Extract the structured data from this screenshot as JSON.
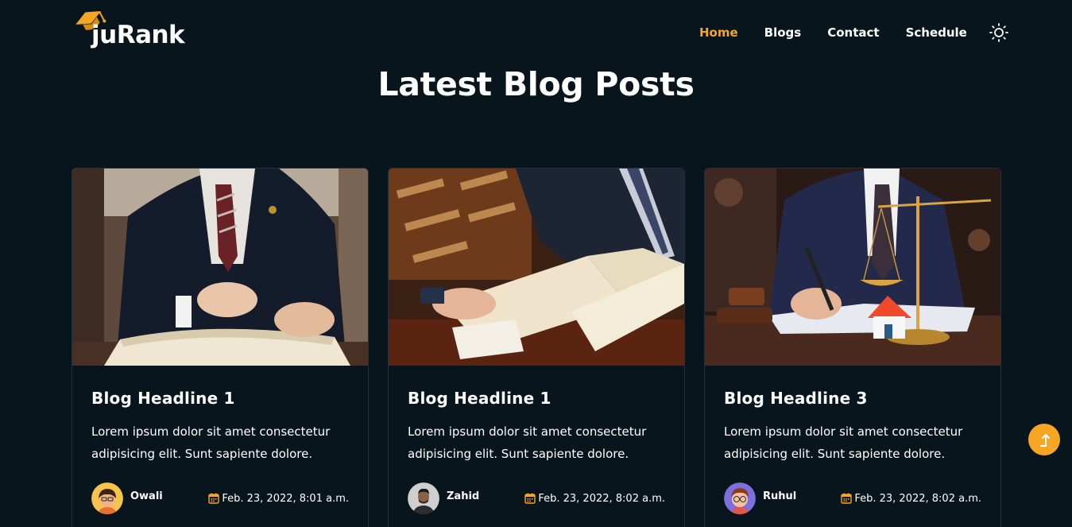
{
  "brand": {
    "name": "juRank",
    "logo_icon": "graduation-cap-icon",
    "accent": "#f6a623"
  },
  "nav": {
    "items": [
      {
        "label": "Home",
        "active": true
      },
      {
        "label": "Blogs",
        "active": false
      },
      {
        "label": "Contact",
        "active": false
      },
      {
        "label": "Schedule",
        "active": false
      }
    ],
    "theme_toggle_icon": "sun-icon"
  },
  "section": {
    "title": "Latest Blog Posts"
  },
  "posts": [
    {
      "title": "Blog Headline 1",
      "excerpt": "Lorem ipsum dolor sit amet consectetur adipisicing elit. Sunt sapiente dolore.",
      "author": "Owali",
      "date": "Feb. 23, 2022, 8:01 a.m."
    },
    {
      "title": "Blog Headline 1",
      "excerpt": "Lorem ipsum dolor sit amet consectetur adipisicing elit. Sunt sapiente dolore.",
      "author": "Zahid",
      "date": "Feb. 23, 2022, 8:02 a.m."
    },
    {
      "title": "Blog Headline 3",
      "excerpt": "Lorem ipsum dolor sit amet consectetur adipisicing elit. Sunt sapiente dolore.",
      "author": "Ruhul",
      "date": "Feb. 23, 2022, 8:02 a.m."
    }
  ],
  "scroll_top": {
    "icon": "arrow-up-icon"
  }
}
